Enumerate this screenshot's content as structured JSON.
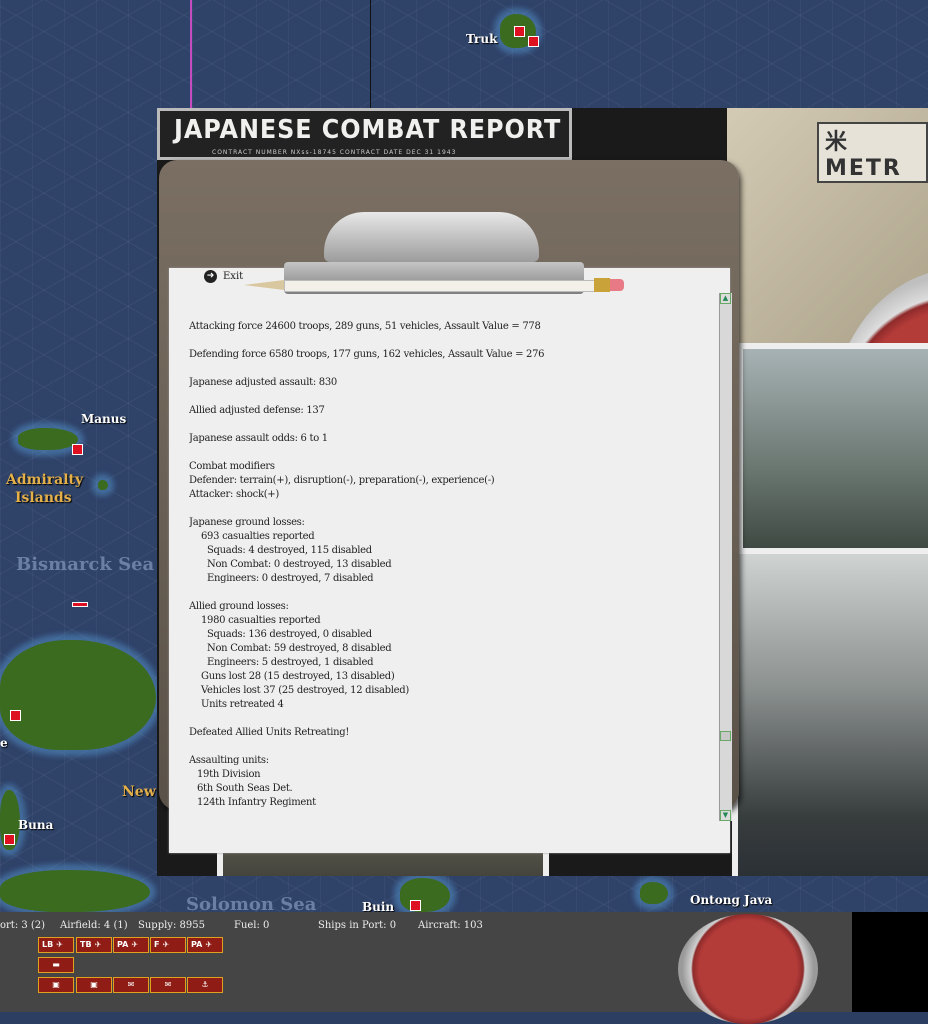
{
  "map": {
    "labels": {
      "truk": "Truk",
      "manus": "Manus",
      "admiralty_1": "Admiralty",
      "admiralty_2": "Islands",
      "bismarck_sea": "Bismarck Sea",
      "new": "New",
      "buna": "Buna",
      "solomon_sea": "Solomon Sea",
      "buin": "Buin",
      "ontong_java": "Ontong Java",
      "edge_e": "e"
    }
  },
  "report": {
    "banner_title": "JAPANESE COMBAT REPORT",
    "banner_sub": "CONTRACT NUMBER  NXss-18745          CONTRACT DATE  DEC  31  1943",
    "photo_text": "米 METR",
    "exit_label": "Exit",
    "lines": [
      {
        "text": "Attacking force 24600 troops, 289 guns, 51 vehicles, Assault Value = 778",
        "indent": 0
      },
      {
        "text": "",
        "indent": 0
      },
      {
        "text": "Defending force 6580 troops, 177 guns, 162 vehicles, Assault Value = 276",
        "indent": 0
      },
      {
        "text": "",
        "indent": 0
      },
      {
        "text": "Japanese adjusted assault: 830",
        "indent": 0
      },
      {
        "text": "",
        "indent": 0
      },
      {
        "text": "Allied adjusted defense: 137",
        "indent": 0
      },
      {
        "text": "",
        "indent": 0
      },
      {
        "text": "Japanese assault odds: 6 to 1",
        "indent": 0
      },
      {
        "text": "",
        "indent": 0
      },
      {
        "text": "Combat modifiers",
        "indent": 0
      },
      {
        "text": "Defender: terrain(+), disruption(-), preparation(-), experience(-)",
        "indent": 0
      },
      {
        "text": "Attacker: shock(+)",
        "indent": 0
      },
      {
        "text": "",
        "indent": 0
      },
      {
        "text": "Japanese ground losses:",
        "indent": 0
      },
      {
        "text": "693 casualties reported",
        "indent": 1
      },
      {
        "text": "Squads: 4 destroyed, 115 disabled",
        "indent": 2
      },
      {
        "text": "Non Combat: 0 destroyed, 13 disabled",
        "indent": 2
      },
      {
        "text": "Engineers: 0 destroyed, 7 disabled",
        "indent": 2
      },
      {
        "text": "",
        "indent": 0
      },
      {
        "text": "Allied ground losses:",
        "indent": 0
      },
      {
        "text": "1980 casualties reported",
        "indent": 1
      },
      {
        "text": "Squads: 136 destroyed, 0 disabled",
        "indent": 2
      },
      {
        "text": "Non Combat: 59 destroyed, 8 disabled",
        "indent": 2
      },
      {
        "text": "Engineers: 5 destroyed, 1 disabled",
        "indent": 2
      },
      {
        "text": "Guns lost 28 (15 destroyed, 13 disabled)",
        "indent": 1
      },
      {
        "text": "Vehicles lost 37 (25 destroyed, 12 disabled)",
        "indent": 1
      },
      {
        "text": "Units retreated 4",
        "indent": 1
      },
      {
        "text": "",
        "indent": 0
      },
      {
        "text": "Defeated Allied Units Retreating!",
        "indent": 0
      },
      {
        "text": "",
        "indent": 0
      },
      {
        "text": "Assaulting units:",
        "indent": 0
      },
      {
        "text": "19th Division",
        "indent": 3
      },
      {
        "text": "6th South Seas Det.",
        "indent": 3
      },
      {
        "text": "124th Infantry Regiment",
        "indent": 3
      }
    ]
  },
  "hud": {
    "port": "ort: 3 (2)",
    "airfield": "Airfield: 4 (1)",
    "supply": "Supply: 8955",
    "fuel": "Fuel: 0",
    "ships_in_port": "Ships in Port: 0",
    "aircraft": "Aircraft: 103",
    "air_buttons": [
      "LB",
      "TB",
      "PA",
      "F",
      "PA"
    ]
  },
  "colors": {
    "sea": "#2f4268",
    "land": "#3b6b1f",
    "hud_button": "#8f1d15",
    "hud_border": "#e0a020",
    "paper": "#efefef"
  }
}
